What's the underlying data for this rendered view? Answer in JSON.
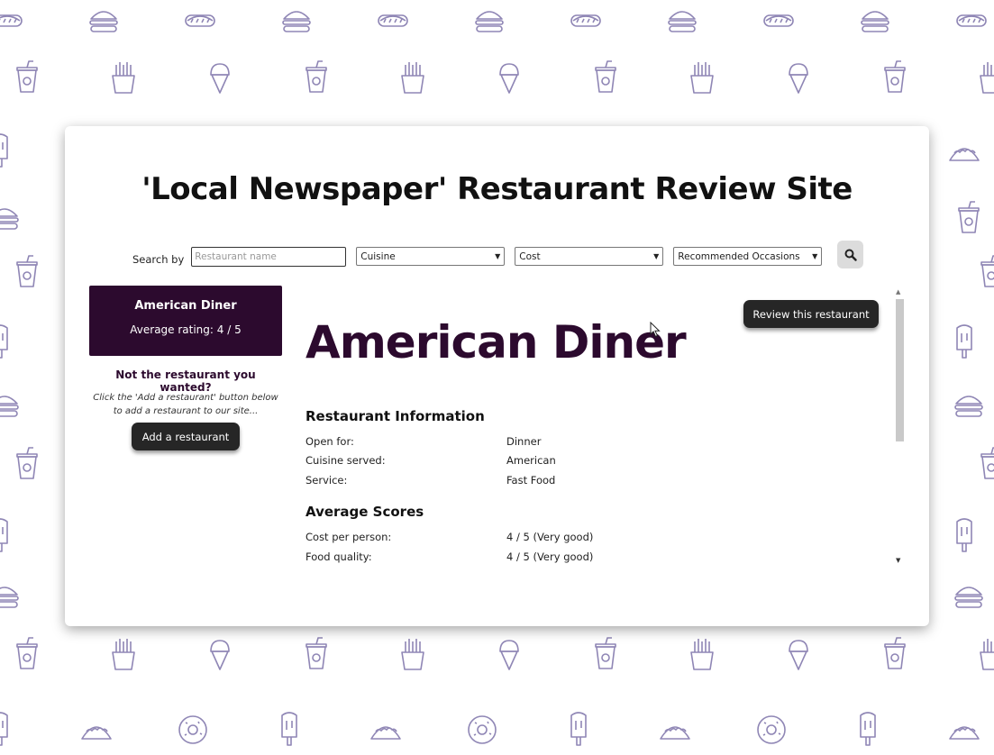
{
  "site": {
    "title": "'Local Newspaper' Restaurant Review Site"
  },
  "search": {
    "label": "Search by",
    "placeholder": "Restaurant name",
    "cuisine": "Cuisine",
    "cost": "Cost",
    "occasions": "Recommended Occasions"
  },
  "sidebar": {
    "card_name": "American Diner",
    "card_rating": "Average rating: 4 / 5",
    "not_wanted": "Not the restaurant you wanted?",
    "hint": "Click the 'Add a restaurant' button below to add a restaurant to our site...",
    "add_button": "Add a restaurant"
  },
  "main": {
    "review_button": "Review this restaurant",
    "restaurant_name": "American Diner",
    "info_heading": "Restaurant Information",
    "info": [
      {
        "key": "Open for:",
        "value": "Dinner"
      },
      {
        "key": "Cuisine served:",
        "value": "American"
      },
      {
        "key": "Service:",
        "value": "Fast Food"
      }
    ],
    "scores_heading": "Average Scores",
    "scores": [
      {
        "key": "Cost per person:",
        "value": "4 / 5 (Very good)"
      },
      {
        "key": "Food quality:",
        "value": "4 / 5 (Very good)"
      }
    ]
  },
  "icons": {
    "search": "search-icon",
    "pattern": [
      "hotdog-icon",
      "burger-icon",
      "drink-cup-icon",
      "ice-cream-icon",
      "fries-icon",
      "popsicle-icon",
      "taco-icon",
      "donut-icon"
    ],
    "pattern_color": "#8f86b5"
  },
  "colors": {
    "accent": "#2c0a2e",
    "button": "#262626"
  }
}
